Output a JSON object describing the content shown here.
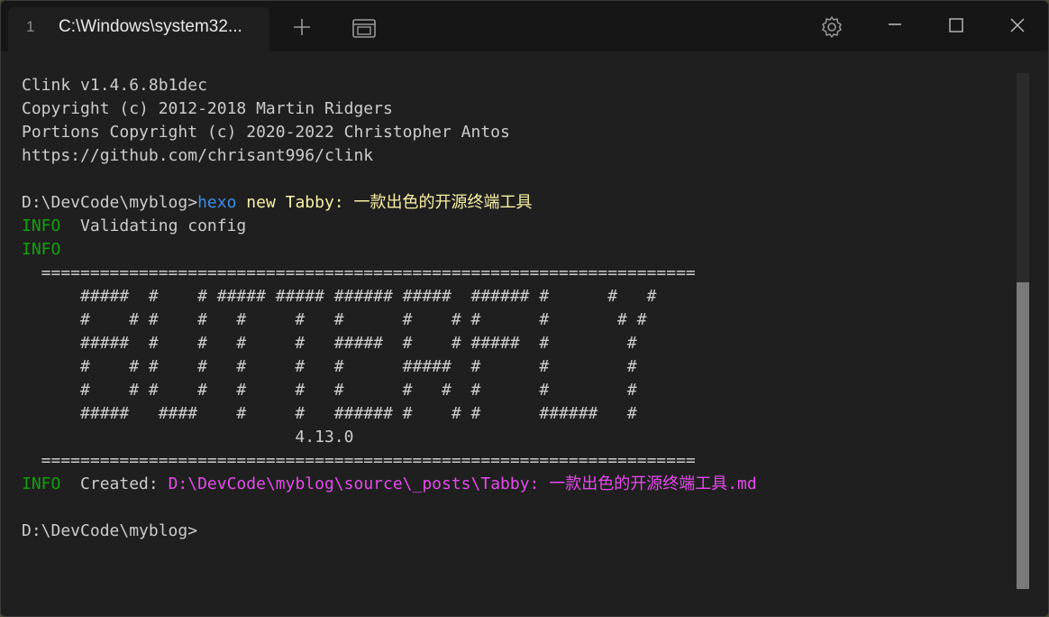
{
  "tab": {
    "index": "1",
    "title": "C:\\Windows\\system32..."
  },
  "icons": {
    "new_tab": "plus-icon",
    "tab_overview": "tab-overview-icon",
    "settings": "gear-icon",
    "minimize": "minimize-icon",
    "maximize": "maximize-icon",
    "close": "close-icon"
  },
  "terminal": {
    "header": [
      "Clink v1.4.6.8b1dec",
      "Copyright (c) 2012-2018 Martin Ridgers",
      "Portions Copyright (c) 2020-2022 Christopher Antos",
      "https://github.com/chrisant996/clink"
    ],
    "prompt1": {
      "path": "D:\\DevCode\\myblog>",
      "command": "hexo",
      "args": " new Tabby: 一款出色的开源终端工具"
    },
    "info_label": "INFO",
    "info1_text": "  Validating config",
    "banner": [
      "  ===================================================================",
      "      #####  #    # ##### ##### ###### #####  ###### #      #   #",
      "      #    # #    #   #     #   #      #    # #      #       # #",
      "      #####  #    #   #     #   #####  #    # #####  #        #",
      "      #    # #    #   #     #   #      #####  #      #        #",
      "      #    # #    #   #     #   #      #   #  #      #        #",
      "      #####   ####    #     #   ###### #    # #      ######   #",
      "                            4.13.0",
      "  ==================================================================="
    ],
    "created_label": "  Created: ",
    "created_path": "D:\\DevCode\\myblog\\source\\_posts\\Tabby: 一款出色的开源终端工具.md",
    "prompt2": "D:\\DevCode\\myblog>"
  },
  "colors": {
    "background": "#1f1f1f",
    "titlebar": "#161616",
    "info": "#13a10e",
    "command": "#3b8eea",
    "args": "#f9f1a5",
    "path_highlight": "#e54bec"
  }
}
